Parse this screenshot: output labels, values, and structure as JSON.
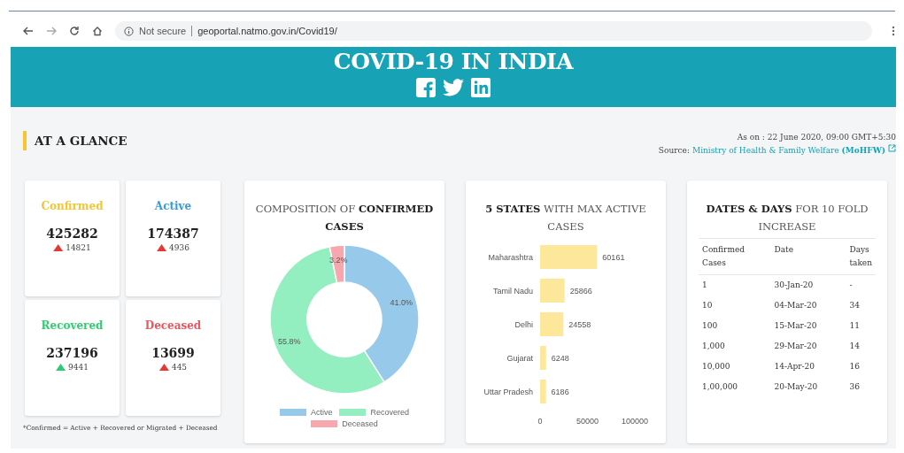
{
  "browser": {
    "security": "Not secure",
    "url": "geoportal.natmo.gov.in/Covid19/"
  },
  "banner": {
    "title": "COVID-19 IN INDIA"
  },
  "glance": {
    "heading": "AT A GLANCE",
    "as_on": "As on : 22 June 2020, 09:00 GMT+5:30",
    "source_label": "Source:",
    "source_link": "Ministry of Health & Family Welfare **(MoHFW)**"
  },
  "stats": [
    {
      "label": "Confirmed",
      "value": "425282",
      "color": "#f7c531",
      "change": {
        "value": "14821",
        "color": "#e53935"
      }
    },
    {
      "label": "Active",
      "value": "174387",
      "color": "#3a9ad9",
      "change": {
        "value": "4936",
        "color": "#e53935"
      }
    },
    {
      "label": "Recovered",
      "value": "237196",
      "color": "#2fcf6f",
      "change": {
        "value": "9441",
        "color": "#2ecc71"
      }
    },
    {
      "label": "Deceased",
      "value": "13699",
      "color": "#f2545b",
      "change": {
        "value": "445",
        "color": "#e53935"
      }
    }
  ],
  "footnote": "*Confirmed = Active + Recovered or Migrated + Deceased",
  "composition": {
    "chart_data": {
      "type": "donut",
      "title": "COMPOSITION OF **CONFIRMED CASES**",
      "categories": [
        "Active",
        "Recovered",
        "Deceased"
      ],
      "values": [
        41.0,
        55.8,
        3.2
      ],
      "colors": [
        "#97c9ea",
        "#93efbf",
        "#f7a7ad"
      ],
      "value_labels": [
        "41.0%",
        "55.8%",
        "3.2%"
      ],
      "legend": "bottom"
    }
  },
  "states": {
    "chart_data": {
      "type": "bar",
      "orientation": "horizontal",
      "title": "**5 STATES** WITH MAX ACTIVE CASES",
      "categories": [
        "Maharashtra",
        "Tamil Nadu",
        "Delhi",
        "Gujarat",
        "Uttar Pradesh"
      ],
      "series": [
        {
          "color": "#fde79a",
          "values": [
            60161,
            25866,
            24558,
            6248,
            6186
          ]
        }
      ],
      "xlim": [
        0,
        100000
      ],
      "xticks": [
        0,
        50000,
        100000
      ],
      "data_labels": true
    }
  },
  "tenfold": {
    "title": "**DATES & DAYS** FOR 10 FOLD INCREASE",
    "columns": [
      "Confirmed Cases",
      "Date",
      "Days taken"
    ],
    "rows": [
      [
        "1",
        "30-Jan-20",
        "-"
      ],
      [
        "10",
        "04-Mar-20",
        "34"
      ],
      [
        "100",
        "15-Mar-20",
        "11"
      ],
      [
        "1,000",
        "29-Mar-20",
        "14"
      ],
      [
        "10,000",
        "14-Apr-20",
        "16"
      ],
      [
        "1,00,000",
        "20-May-20",
        "36"
      ]
    ]
  }
}
